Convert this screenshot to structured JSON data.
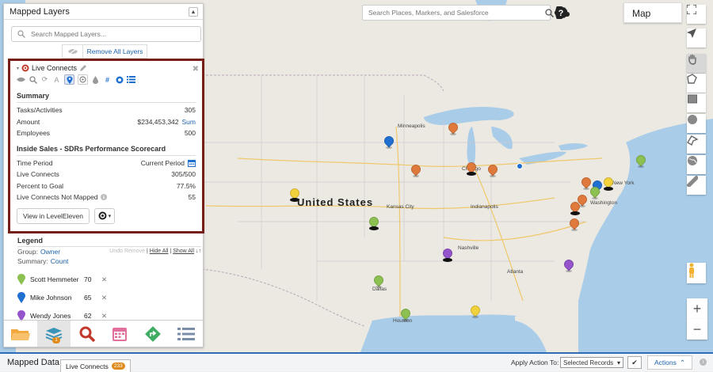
{
  "map": {
    "search_placeholder": "Search Places, Markers, and Salesforce",
    "type_label": "Map",
    "country_label": "United States",
    "city_labels": [
      "Minneapolis",
      "Chicago",
      "Kansas City",
      "Indianapolis",
      "Nashville",
      "Atlanta",
      "Dallas",
      "Houston",
      "New York",
      "Washington"
    ],
    "colors": {
      "green": "#8cc152",
      "blue": "#1f6fd1",
      "orange": "#e07a3c",
      "yellow": "#f2d23c",
      "purple": "#9553cc"
    }
  },
  "panel": {
    "title": "Mapped Layers",
    "search_placeholder": "Search Mapped Layers...",
    "remove_all_label": "Remove All Layers",
    "live_connects": {
      "title": "Live Connects",
      "summary_title": "Summary",
      "summary_rows": [
        {
          "label": "Tasks/Activities",
          "value": "305"
        },
        {
          "label": "Amount",
          "value": "$234,453,342",
          "link": "Sum"
        },
        {
          "label": "Employees",
          "value": "500"
        }
      ],
      "scorecard_title": "Inside Sales - SDRs Performance Scorecard",
      "scorecard_rows": [
        {
          "label": "Time Period",
          "value": "Current Period"
        },
        {
          "label": "Live Connects",
          "value": "305/500"
        },
        {
          "label": "Percent to Goal",
          "value": "77.5%"
        },
        {
          "label": "Live Connects Not Mapped",
          "value": "55"
        }
      ],
      "view_button": "View in LevelEleven"
    },
    "legend": {
      "title": "Legend",
      "group_label": "Group:",
      "group_value": "Owner",
      "summary_label": "Summary:",
      "summary_value": "Count",
      "action_undo": "Undo Remove",
      "action_hide": "Hide All",
      "action_show": "Show All",
      "items": [
        {
          "name": "Scott Hemmeter",
          "count": "70",
          "color": "#8cc152"
        },
        {
          "name": "Mike Johnson",
          "count": "65",
          "color": "#1f6fd1"
        },
        {
          "name": "Wendy Jones",
          "count": "62",
          "color": "#9553cc"
        }
      ]
    },
    "tab_badge": "1"
  },
  "bottombar": {
    "title": "Mapped Data",
    "tab_label": "Live Connects",
    "tab_count": "233",
    "apply_label": "Apply Action To:",
    "apply_value": "Selected Records",
    "actions_label": "Actions"
  }
}
